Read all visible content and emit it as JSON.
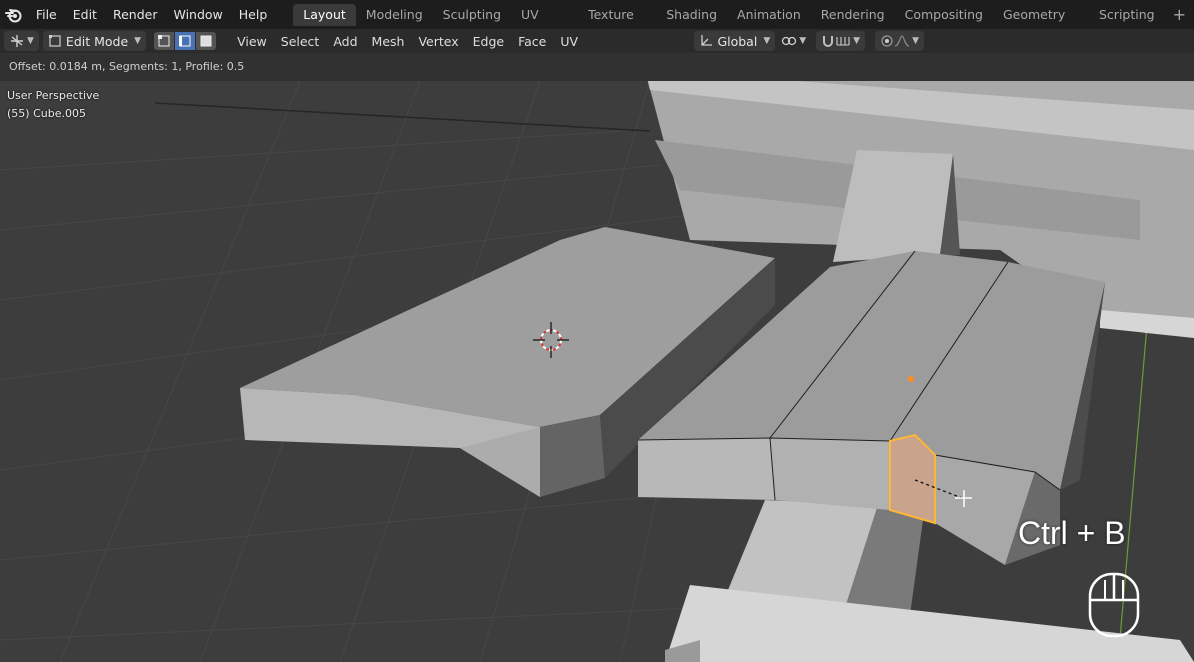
{
  "top_menu": [
    "File",
    "Edit",
    "Render",
    "Window",
    "Help"
  ],
  "workspace_tabs": [
    "Layout",
    "Modeling",
    "Sculpting",
    "UV Editing",
    "Texture Paint",
    "Shading",
    "Animation",
    "Rendering",
    "Compositing",
    "Geometry Nodes",
    "Scripting"
  ],
  "active_tab": "Layout",
  "header": {
    "mode": "Edit Mode",
    "menus": [
      "View",
      "Select",
      "Add",
      "Mesh",
      "Vertex",
      "Edge",
      "Face",
      "UV"
    ],
    "transform_orientation": "Global",
    "select_mode_active": "edge"
  },
  "operator_panel": {
    "text": "Offset: 0.0184 m, Segments: 1, Profile: 0.5"
  },
  "viewport": {
    "view_name": "User Perspective",
    "object_name": "(55) Cube.005"
  },
  "shortcut_overlay": {
    "text": "Ctrl + B"
  },
  "colors": {
    "background": "#3d3d3d",
    "topbar": "#1d1d1d",
    "header": "#2b2b2b",
    "active_select": "#4772b3",
    "selection_highlight": "#ffb733",
    "object_origin": "#ff8c1a"
  }
}
